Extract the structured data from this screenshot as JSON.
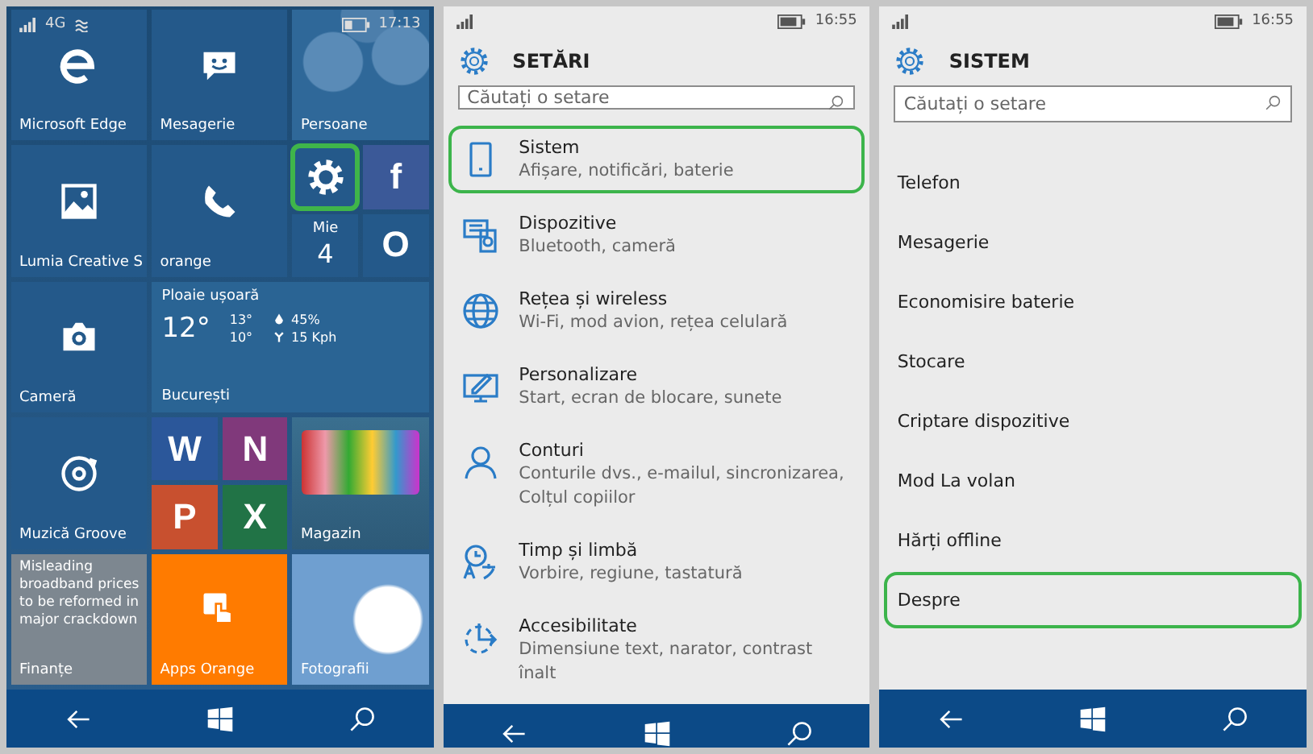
{
  "phones": [
    {
      "kind": "start",
      "status": {
        "network": "4G",
        "time": "17:13"
      },
      "tiles": [
        {
          "kind": "app",
          "label": "Microsoft Edge",
          "color": "#24598a",
          "highlighted": false
        },
        {
          "kind": "app",
          "label": "Mesagerie",
          "color": "#24598a",
          "highlighted": false
        },
        {
          "kind": "picture",
          "label": "Persoane",
          "color": "#2f6899",
          "highlighted": false
        },
        {
          "kind": "app",
          "label": "Lumia Creative S",
          "color": "#24598a",
          "highlighted": false
        },
        {
          "kind": "app",
          "label": "orange",
          "color": "#24598a",
          "highlighted": false
        },
        {
          "kind": "app",
          "color": "#24598a",
          "highlighted": true
        },
        {
          "kind": "glyph",
          "glyph": "f",
          "color": "#3b5998",
          "highlighted": false
        },
        {
          "kind": "calendar",
          "day": "Mie",
          "date": "4",
          "color": "#24598a",
          "highlighted": false
        },
        {
          "kind": "glyph",
          "glyph": "O",
          "color": "#24598a",
          "highlighted": false
        },
        {
          "kind": "app",
          "label": "Cameră",
          "color": "#24598a",
          "highlighted": false
        },
        {
          "kind": "weather",
          "condition": "Ploaie ușoară",
          "temp": "12°",
          "high": "13°",
          "low": "10°",
          "humidity": "45%",
          "wind": "15 Kph",
          "city": "București",
          "color": "#2a6494",
          "highlighted": false
        },
        {
          "kind": "app",
          "label": "Muzică Groove",
          "color": "#24598a",
          "highlighted": false
        },
        {
          "kind": "glyph",
          "glyph": "W",
          "color": "#2b579a",
          "highlighted": false
        },
        {
          "kind": "glyph",
          "glyph": "N",
          "color": "#80397b",
          "highlighted": false
        },
        {
          "kind": "glyph",
          "glyph": "P",
          "color": "#c8502f",
          "highlighted": false
        },
        {
          "kind": "glyph",
          "glyph": "X",
          "color": "#217346",
          "highlighted": false
        },
        {
          "kind": "picture",
          "label": "Magazin",
          "color": "#3a6f8f",
          "highlighted": false
        },
        {
          "kind": "news",
          "headline": "Misleading broadband prices to be reformed in major crackdown",
          "label": "Finanțe",
          "color": "#7d8790",
          "highlighted": false
        },
        {
          "kind": "app",
          "label": "Apps Orange",
          "color": "#ff7b00",
          "highlighted": false
        },
        {
          "kind": "picture",
          "label": "Fotografii",
          "color": "#6f9fd0",
          "highlighted": false
        }
      ]
    },
    {
      "kind": "settings",
      "status": {
        "time": "16:55"
      },
      "header": {
        "title": "SETĂRI"
      },
      "search": {
        "placeholder": "Căutați o setare"
      },
      "items": [
        {
          "title": "Sistem",
          "subtitle": "Afișare, notificări, baterie",
          "highlighted": true
        },
        {
          "title": "Dispozitive",
          "subtitle": "Bluetooth, cameră",
          "highlighted": false
        },
        {
          "title": "Rețea și wireless",
          "subtitle": "Wi-Fi, mod avion, rețea celulară",
          "highlighted": false
        },
        {
          "title": "Personalizare",
          "subtitle": "Start, ecran de blocare, sunete",
          "highlighted": false
        },
        {
          "title": "Conturi",
          "subtitle": "Conturile dvs., e-mailul, sincronizarea, Colțul copiilor",
          "highlighted": false
        },
        {
          "title": "Timp și limbă",
          "subtitle": "Vorbire, regiune, tastatură",
          "highlighted": false
        },
        {
          "title": "Accesibilitate",
          "subtitle": "Dimensiune text, narator, contrast înalt",
          "highlighted": false
        }
      ]
    },
    {
      "kind": "settings",
      "status": {
        "time": "16:55"
      },
      "header": {
        "title": "SISTEM"
      },
      "search": {
        "placeholder": "Căutați o setare"
      },
      "items": [
        {
          "title": "Telefon",
          "highlighted": false
        },
        {
          "title": "Mesagerie",
          "highlighted": false
        },
        {
          "title": "Economisire baterie",
          "highlighted": false
        },
        {
          "title": "Stocare",
          "highlighted": false
        },
        {
          "title": "Criptare dispozitive",
          "highlighted": false
        },
        {
          "title": "Mod La volan",
          "highlighted": false
        },
        {
          "title": "Hărți offline",
          "highlighted": false
        },
        {
          "title": "Despre",
          "highlighted": true
        }
      ]
    }
  ]
}
